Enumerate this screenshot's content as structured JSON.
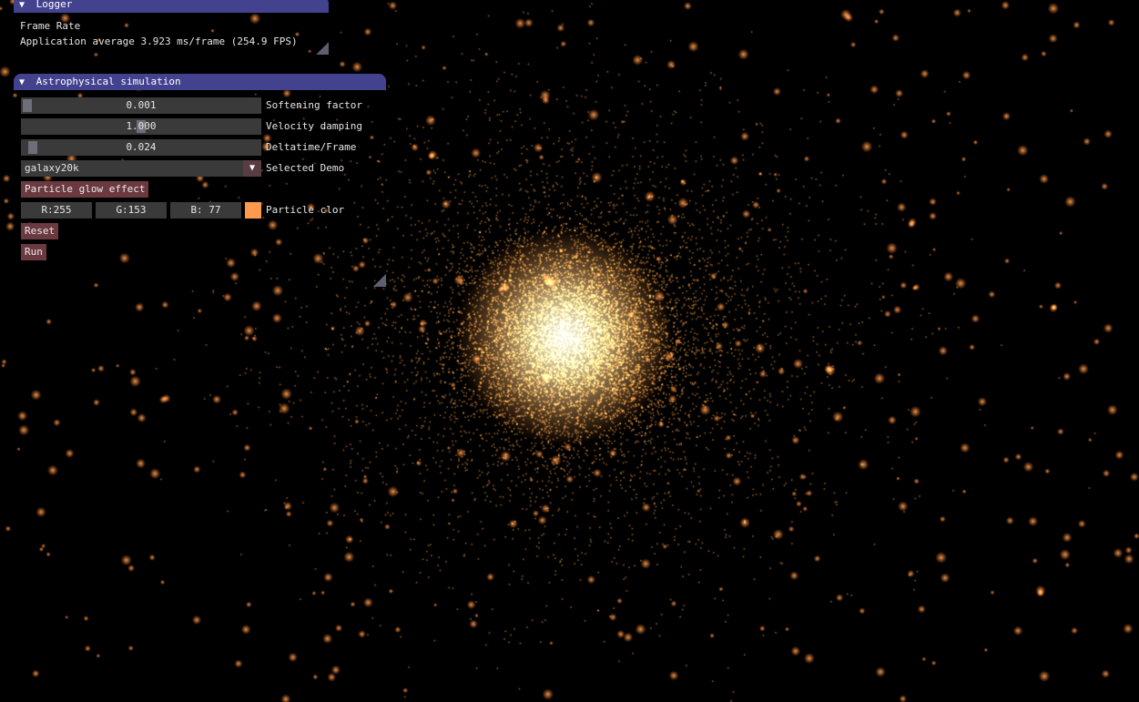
{
  "logger": {
    "title": "Logger",
    "line1": "Frame Rate",
    "line2": "Application average 3.923 ms/frame (254.9 FPS)"
  },
  "sim_panel": {
    "title": "Astrophysical simulation",
    "softening": {
      "value": "0.001",
      "label": "Softening factor",
      "fraction": 0.01
    },
    "damping": {
      "value": "1.000",
      "label": "Velocity damping",
      "fraction": 0.5
    },
    "deltatime": {
      "value": "0.024",
      "label": "Deltatime/Frame",
      "fraction": 0.03
    },
    "demo": {
      "value": "galaxy20k",
      "label": "Selected Demo"
    },
    "glow_button": "Particle glow effect",
    "color": {
      "r": "R:255",
      "g": "G:153",
      "b": "B: 77",
      "label": "Particle clor",
      "swatch": "#ff994d"
    },
    "reset_button": "Reset",
    "run_button": "Run"
  },
  "colors": {
    "title_bar": "#43428f",
    "button": "#6b3a41",
    "frame": "#3a3a3a",
    "particle": "#ff994d",
    "background": "#000000"
  },
  "icons": {
    "collapse": "triangle-down-icon",
    "combo": "triangle-down-icon"
  }
}
